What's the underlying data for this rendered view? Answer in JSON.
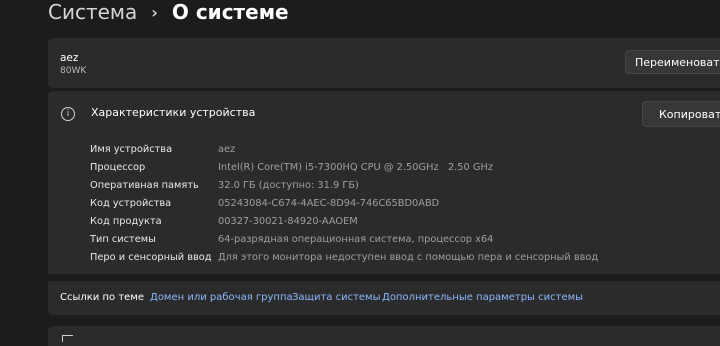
{
  "breadcrumb": {
    "parent": "Система",
    "separator": "›",
    "current": "О системе"
  },
  "device": {
    "name": "aez",
    "model": "80WK",
    "rename_label": "Переименовать этот ПК"
  },
  "specs": {
    "title": "Характеристики устройства",
    "copy_label": "Копировать",
    "info_icon": "info-icon",
    "rows": [
      {
        "label": "Имя устройства",
        "value": "aez"
      },
      {
        "label": "Процессор",
        "value": "Intel(R) Core(TM) i5-7300HQ CPU @ 2.50GHz   2.50 GHz"
      },
      {
        "label": "Оперативная память",
        "value": "32.0 ГБ (доступно: 31.9 ГБ)"
      },
      {
        "label": "Код устройства",
        "value": "05243084-C674-4AEC-8D94-746C65BD0ABD"
      },
      {
        "label": "Код продукта",
        "value": "00327-30021-84920-AAOEM"
      },
      {
        "label": "Тип системы",
        "value": "64-разрядная операционная система, процессор x64"
      },
      {
        "label": "Перо и сенсорный ввод",
        "value": "Для этого монитора недоступен ввод с помощью пера и сенсорный ввод"
      }
    ]
  },
  "related": {
    "label": "Ссылки по теме",
    "links": [
      "Домен или рабочая группа",
      "Защита системы",
      "Дополнительные параметры системы"
    ]
  },
  "colors": {
    "background": "#1c1c1c",
    "card": "#2b2b2b",
    "link": "#8ab8ff"
  }
}
